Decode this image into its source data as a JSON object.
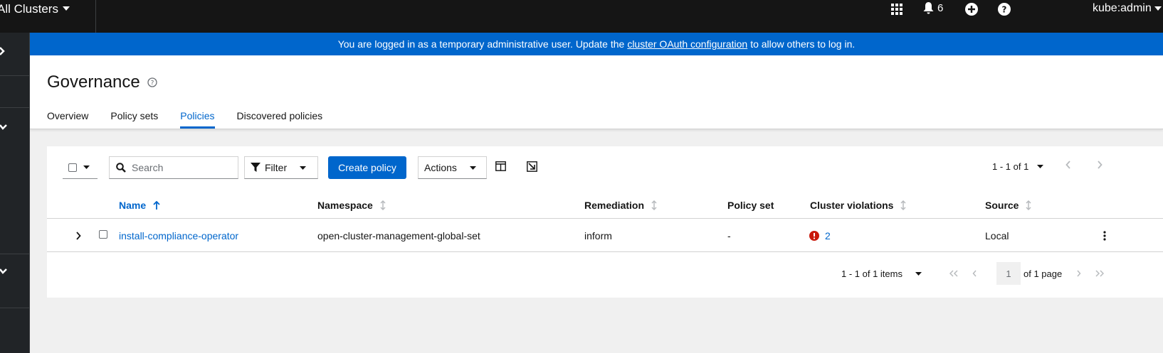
{
  "masthead": {
    "cluster_switcher": "All Clusters",
    "notifications_count": "6",
    "user": "kube:admin"
  },
  "banner": {
    "text_before": "You are logged in as a temporary administrative user. Update the",
    "link": "cluster OAuth configuration",
    "text_after": "to allow others to log in."
  },
  "page": {
    "title": "Governance",
    "tabs": [
      {
        "label": "Overview",
        "active": false
      },
      {
        "label": "Policy sets",
        "active": false
      },
      {
        "label": "Policies",
        "active": true
      },
      {
        "label": "Discovered policies",
        "active": false
      }
    ]
  },
  "toolbar": {
    "search_placeholder": "Search",
    "filter_label": "Filter",
    "create_label": "Create policy",
    "actions_label": "Actions",
    "pagination_top": "1 - 1 of 1"
  },
  "table": {
    "columns": [
      "Name",
      "Namespace",
      "Remediation",
      "Policy set",
      "Cluster violations",
      "Source"
    ],
    "rows": [
      {
        "name": "install-compliance-operator",
        "namespace": "open-cluster-management-global-set",
        "remediation": "inform",
        "policy_set": "-",
        "cluster_violations": "2",
        "source": "Local"
      }
    ]
  },
  "pagination_bottom": {
    "items": "1 - 1 of 1 items",
    "page": "1",
    "of_pages": "of 1 page"
  },
  "colors": {
    "accent": "#0066cc",
    "masthead": "#151515",
    "sidebar": "#212427",
    "danger": "#c9190b"
  }
}
